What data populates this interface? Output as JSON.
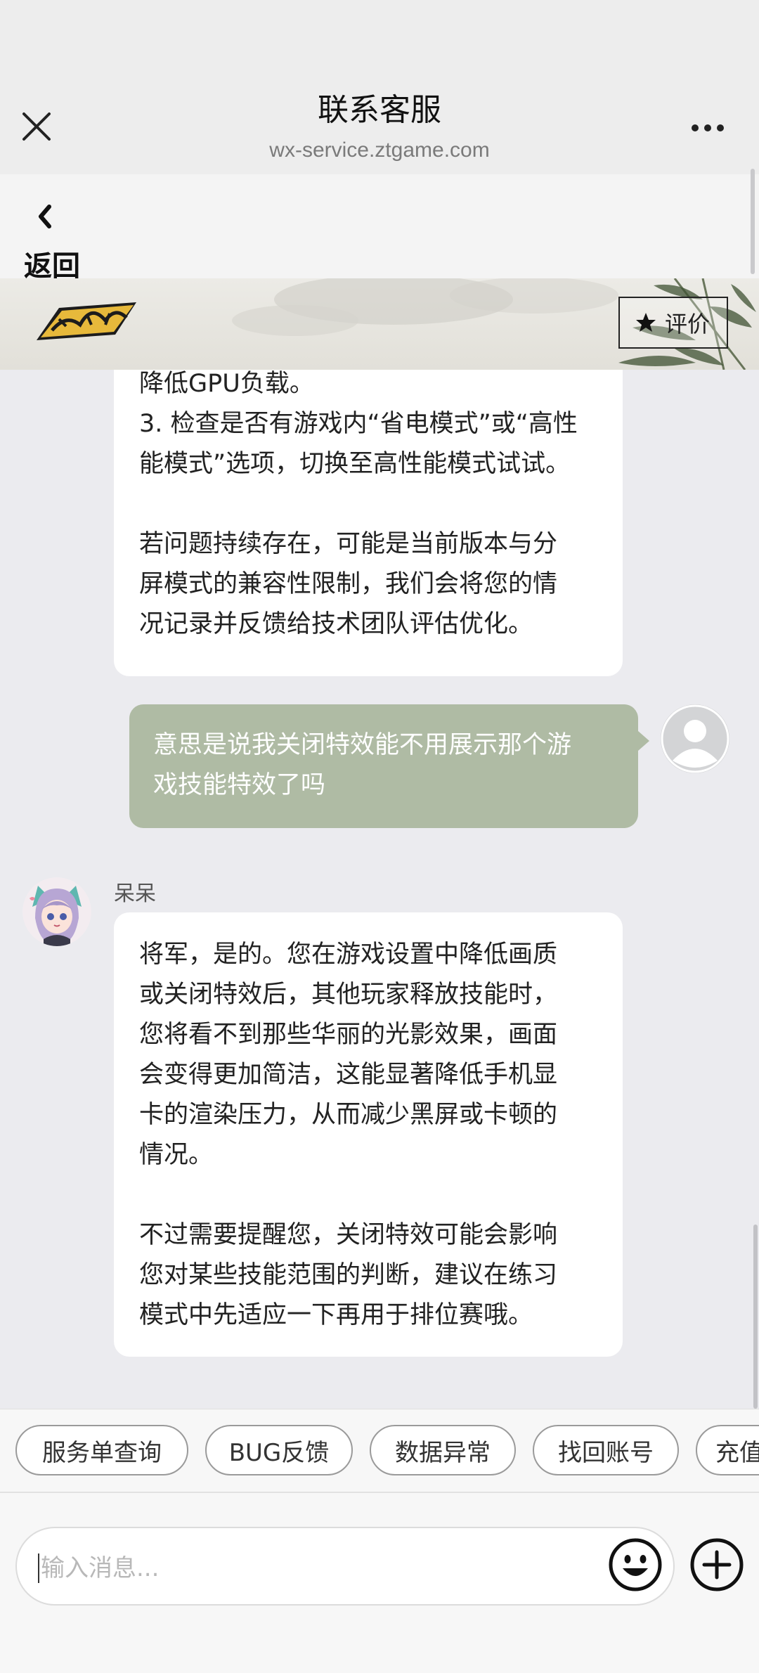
{
  "header": {
    "title": "联系客服",
    "domain": "wx-service.ztgame.com"
  },
  "nav": {
    "back_label": "返回"
  },
  "banner": {
    "rate_label": "评价"
  },
  "messages": [
    {
      "from": "agent",
      "lines": [
        "降低GPU负载。",
        "3. 检查是否有游戏内“省电模式”或“高性",
        "能模式”选项，切换至高性能模式试试。",
        "",
        "若问题持续存在，可能是当前版本与分",
        "屏模式的兼容性限制，我们会将您的情",
        "况记录并反馈给技术团队评估优化。"
      ]
    },
    {
      "from": "user",
      "lines": [
        "意思是说我关闭特效能不用展示那个游",
        "戏技能特效了吗"
      ]
    },
    {
      "from": "agent",
      "name": "呆呆",
      "lines": [
        "将军，是的。您在游戏设置中降低画质",
        "或关闭特效后，其他玩家释放技能时，",
        "您将看不到那些华丽的光影效果，画面",
        "会变得更加简洁，这能显著降低手机显",
        "卡的渲染压力，从而减少黑屏或卡顿的",
        "情况。",
        "",
        "不过需要提醒您，关闭特效可能会影响",
        "您对某些技能范围的判断，建议在练习",
        "模式中先适应一下再用于排位赛哦。"
      ]
    }
  ],
  "quick_replies": [
    "服务单查询",
    "BUG反馈",
    "数据异常",
    "找回账号",
    "充值"
  ],
  "input": {
    "placeholder": "输入消息...",
    "value": ""
  },
  "colors": {
    "user_bubble": "#afbba4",
    "agent_bubble": "#ffffff",
    "chat_background": "#ebebef"
  }
}
